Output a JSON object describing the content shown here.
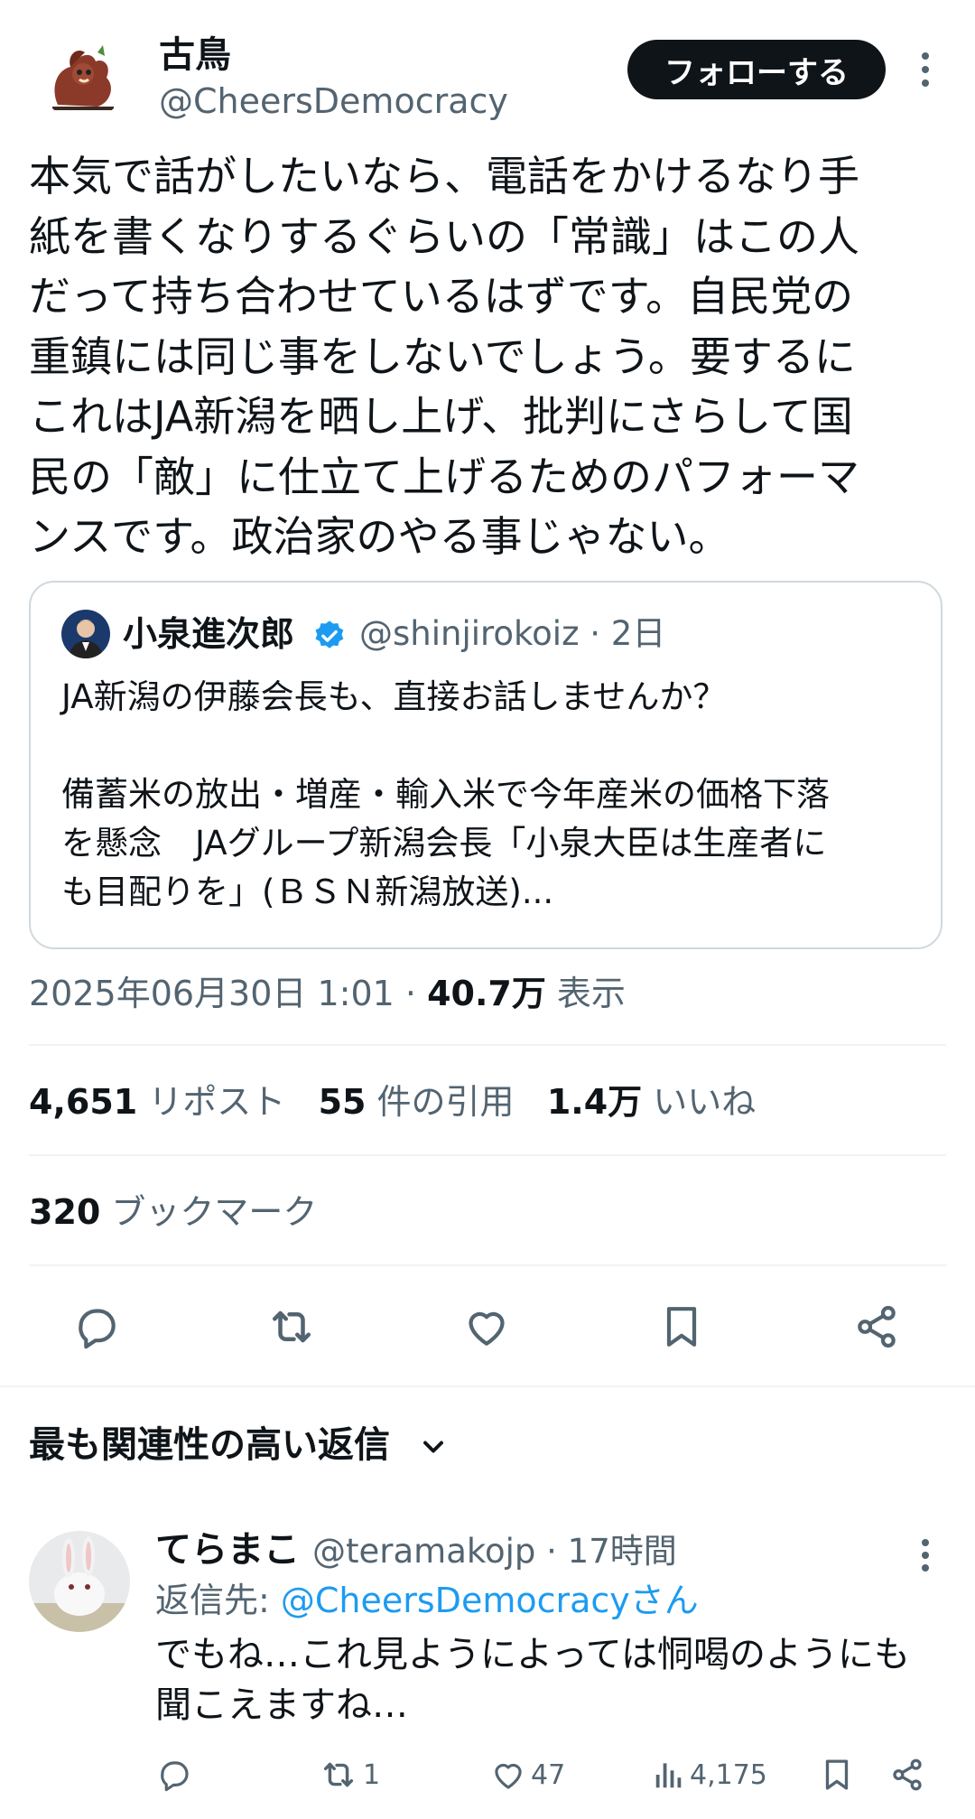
{
  "author": {
    "name": "古鳥",
    "handle": "@CheersDemocracy",
    "avatar_icon": "red-panda-avatar-icon"
  },
  "follow_button": "フォローする",
  "tweet_text": "本気で話がしたいなら、電話をかけるなり手\n紙を書くなりするぐらいの「常識」はこの人\nだって持ち合わせているはずです。自民党の\n重鎮には同じ事をしないでしょう。要するに\nこれはJA新潟を晒し上げ、批判にさらして国\n民の「敵」に仕立て上げるためのパフォーマ\nンスです。政治家のやる事じゃない。",
  "quote": {
    "name": "小泉進次郎",
    "handle": "@shinjirokoiz",
    "time": "2日",
    "meta": "@shinjirokoiz · 2日",
    "text": "JA新潟の伊藤会長も、直接お話しませんか？\n\n備蓄米の放出・増産・輸入米で今年産米の価格下落\nを懸念　JAグループ新潟会長「小泉大臣は生産者に\nも目配りを」(ＢＳＮ新潟放送)...",
    "verified_color": "#1d9bf0"
  },
  "timestamp": {
    "datetime": "2025年06月30日 1:01 · ",
    "views": "40.7万",
    "views_label": " 表示"
  },
  "stats": {
    "reposts": "4,651",
    "reposts_label": "リポスト",
    "quotes": "55",
    "quotes_label": "件の引用",
    "likes": "1.4万",
    "likes_label": "いいね",
    "bookmarks": "320",
    "bookmarks_label": "ブックマーク"
  },
  "sort_label": "最も関連性の高い返信",
  "reply": {
    "name": "てらまこ",
    "meta": "@teramakojp · 17時間",
    "reply_to_prefix": "返信先: ",
    "reply_to_handle": "@CheersDemocracyさん",
    "text": "でもね…これ見ようによっては恫喝のようにも\n聞こえますね…",
    "retweets": "1",
    "likes": "47",
    "views": "4,175"
  },
  "colors": {
    "text": "#0f1419",
    "secondary": "#536471",
    "accent": "#1d9bf0",
    "border": "#cfd9de"
  }
}
